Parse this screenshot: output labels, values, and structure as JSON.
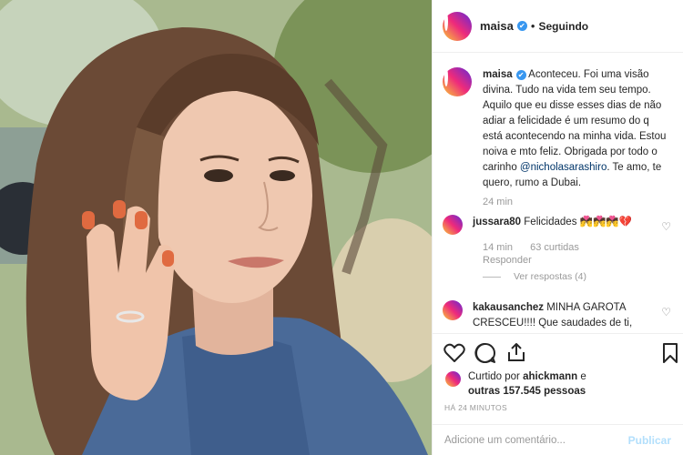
{
  "post": {
    "username": "maisa",
    "verified_mark": "✔",
    "separator": "•",
    "follow_status": "Seguindo"
  },
  "caption": {
    "username": "maisa",
    "text_before_mention": " Aconteceu. Foi uma visão divina. Tudo na vida tem seu tempo. Aquilo que eu disse esses dias de não adiar a felicidade é um resumo do q está acontecendo na minha vida. Estou noiva e mto feliz. Obrigada por todo o carinho ",
    "mention": "@nicholasarashiro",
    "text_after_mention": ". Te amo, te quero, rumo a Dubai.",
    "time": "24 min"
  },
  "comments": [
    {
      "username": "jussara80",
      "text": "Felicidades 💏💏💏💔",
      "time": "14 min",
      "likes": "63 curtidas",
      "reply_label": "Responder",
      "view_replies": "Ver respostas (4)"
    },
    {
      "username": "kakausanchez",
      "text": "MINHA GAROTA CRESCEU!!!! Que saudades de ti,"
    }
  ],
  "likes": {
    "prefix": "Curtido por",
    "user": "ahickmann",
    "connector": "e",
    "others": "outras 157.545 pessoas"
  },
  "timestamp": "HÁ 24 MINUTOS",
  "add_comment": {
    "placeholder": "Adicione um comentário...",
    "publish_label": "Publicar"
  },
  "icons": {
    "like": "heart-icon",
    "comment": "comment-icon",
    "share": "share-icon",
    "save": "bookmark-icon"
  },
  "colors": {
    "verified": "#3897f0",
    "mention": "#003569",
    "publish_disabled": "#b2dffc"
  }
}
